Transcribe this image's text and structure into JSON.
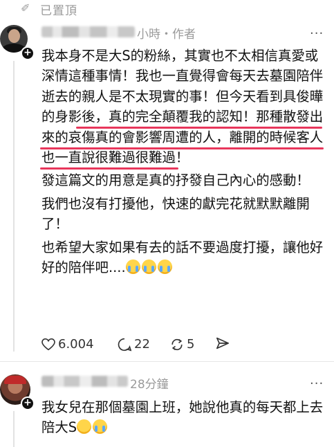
{
  "pinned": {
    "icon": "pin-icon",
    "label": "已置頂"
  },
  "post": {
    "author_avatar": "avatar",
    "meta": "小時・作者",
    "more": "...",
    "paragraphs": [
      "我本身不是大S的粉絲，其實也不太相信真愛或深情這種事情！我也一直覺得會每天去墓園陪伴逝去的親人是不太現實的事！但今天看到具俊曄的身影後，真的完全顛覆我的認知！那種散發出來的哀傷真的會影響周遭的人，離開的時候客人也一直說很難過很難過！",
      "發這篇文的用意是真的抒發自己內心的感動！",
      "我們也沒有打擾他，快速的獻完花就默默離開了！",
      "也希望大家如果有去的話不要過度打擾，讓他好好的陪伴吧...."
    ],
    "likes": "6.004",
    "comments": "22",
    "reposts": "5",
    "highlight_color": "#e8365b"
  },
  "reply": {
    "meta": "28分鐘",
    "more": "...",
    "text": "我女兒在那個墓園上班，她說他真的每天都上去陪大S"
  }
}
